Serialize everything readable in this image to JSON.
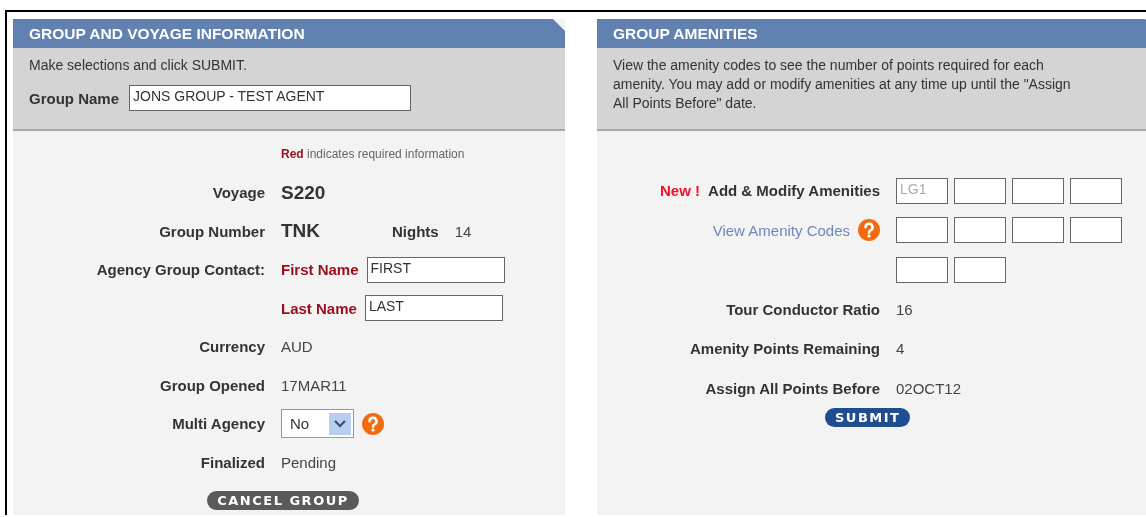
{
  "left_panel": {
    "title": "GROUP AND VOYAGE INFORMATION",
    "intro": "Make selections and click SUBMIT.",
    "group_name": {
      "label": "Group Name",
      "value": "JONS GROUP - TEST AGENT"
    },
    "required_note": {
      "highlight": "Red",
      "text": "indicates required information"
    },
    "rows": [
      {
        "kind": "big",
        "label": "Voyage",
        "value": "S220"
      },
      {
        "kind": "big",
        "label": "Group Number",
        "value": "TNK",
        "extra": {
          "label": "Nights",
          "value": "14"
        }
      },
      {
        "kind": "input",
        "label": "Agency Group Contact:",
        "field_label": "First Name",
        "value": "FIRST"
      },
      {
        "kind": "input",
        "field_label": "Last Name",
        "value": "LAST"
      },
      {
        "kind": "value",
        "label": "Currency",
        "value": "AUD"
      },
      {
        "kind": "value",
        "label": "Group Opened",
        "value": "17MAR11"
      },
      {
        "kind": "select",
        "label": "Multi Agency",
        "value": "No"
      },
      {
        "kind": "value",
        "label": "Finalized",
        "value": "Pending"
      }
    ],
    "button": "CANCEL GROUP"
  },
  "right_panel": {
    "title": "GROUP AMENITIES",
    "intro": "View the amenity codes to see the number of points required for each amenity. You may add or modify amenities at any time up until the \"Assign All Points Before\" date.",
    "rows": [
      {
        "kind": "boxes",
        "badge": "New !",
        "label": "Add & Modify Amenities",
        "boxes": [
          {
            "kind": "hint",
            "placeholder": "LG1"
          },
          {
            "kind": "blank"
          },
          {
            "kind": "blank"
          },
          {
            "kind": "blank"
          }
        ]
      },
      {
        "kind": "boxes",
        "link": "View Amenity Codes",
        "boxes": [
          {
            "kind": "blank"
          },
          {
            "kind": "blank"
          },
          {
            "kind": "blank"
          },
          {
            "kind": "blank"
          }
        ]
      },
      {
        "kind": "boxes",
        "boxes": [
          {
            "kind": "blank"
          },
          {
            "kind": "blank"
          }
        ]
      },
      {
        "kind": "value",
        "label": "Tour Conductor Ratio",
        "value": "16"
      },
      {
        "kind": "value",
        "label": "Amenity Points Remaining",
        "value": "4"
      },
      {
        "kind": "value",
        "label": "Assign All Points Before",
        "value": "02OCT12"
      }
    ],
    "button": "SUBMIT"
  }
}
